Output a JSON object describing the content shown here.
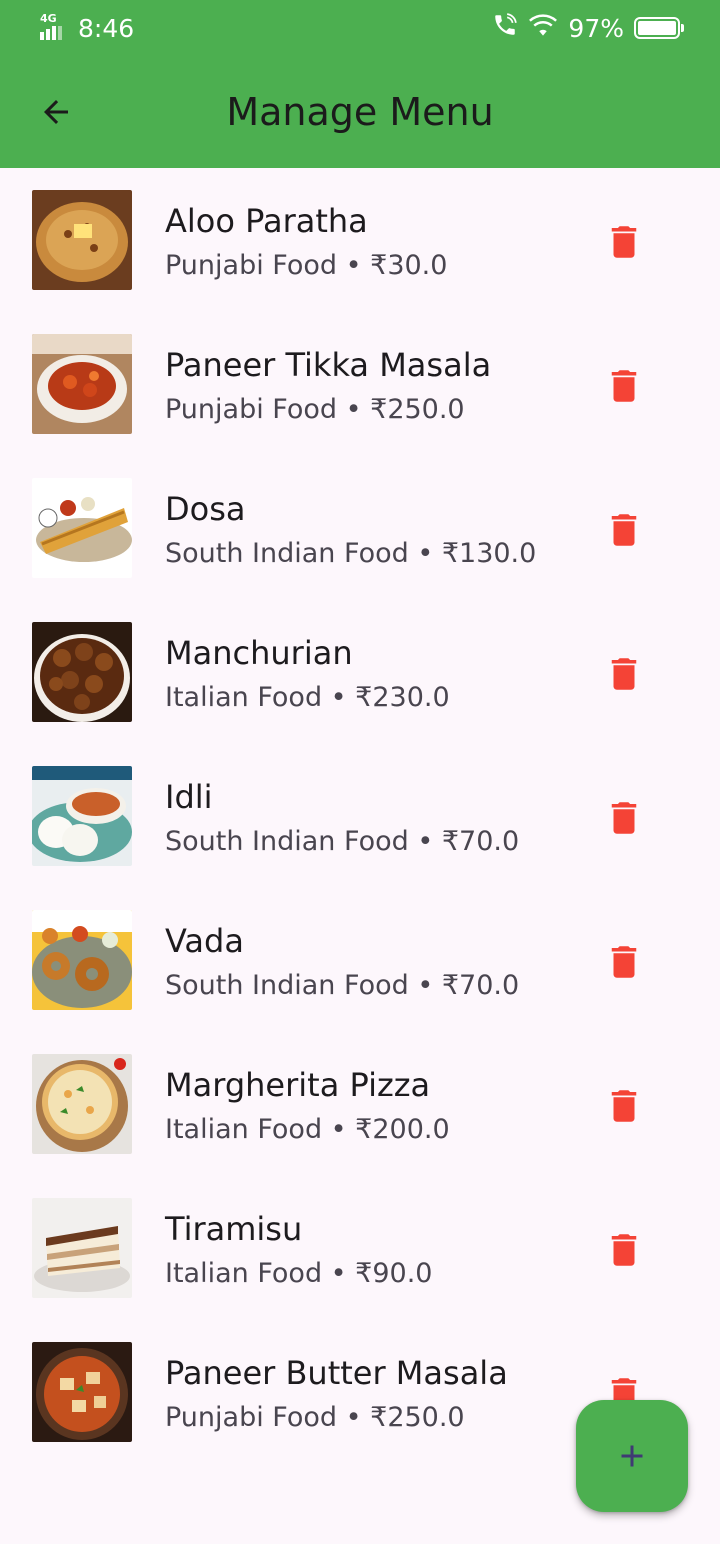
{
  "status_bar": {
    "time": "8:46",
    "network": "4G",
    "battery": "97%",
    "icons": [
      "signal-icon",
      "call-wifi-icon",
      "wifi-icon",
      "battery-icon"
    ]
  },
  "app_bar": {
    "title": "Manage Menu",
    "back_icon": "arrow-back-icon",
    "color": "#4caf50"
  },
  "menu_items": [
    {
      "name": "Aloo Paratha",
      "category": "Punjabi Food",
      "price": "₹30.0",
      "subtitle": "Punjabi Food • ₹30.0"
    },
    {
      "name": "Paneer Tikka Masala",
      "category": "Punjabi Food",
      "price": "₹250.0",
      "subtitle": "Punjabi Food • ₹250.0"
    },
    {
      "name": "Dosa",
      "category": "South Indian Food",
      "price": "₹130.0",
      "subtitle": "South Indian Food • ₹130.0"
    },
    {
      "name": "Manchurian",
      "category": "Italian Food",
      "price": "₹230.0",
      "subtitle": "Italian Food • ₹230.0"
    },
    {
      "name": "Idli",
      "category": "South Indian Food",
      "price": "₹70.0",
      "subtitle": "South Indian Food • ₹70.0"
    },
    {
      "name": "Vada",
      "category": "South Indian Food",
      "price": "₹70.0",
      "subtitle": "South Indian Food • ₹70.0"
    },
    {
      "name": "Margherita Pizza",
      "category": "Italian Food",
      "price": "₹200.0",
      "subtitle": "Italian Food • ₹200.0"
    },
    {
      "name": "Tiramisu",
      "category": "Italian Food",
      "price": "₹90.0",
      "subtitle": "Italian Food • ₹90.0"
    },
    {
      "name": "Paneer Butter Masala",
      "category": "Punjabi Food",
      "price": "₹250.0",
      "subtitle": "Punjabi Food • ₹250.0"
    }
  ],
  "delete_icon": "delete-icon",
  "delete_color": "#f44336",
  "fab": {
    "icon": "add-icon",
    "color": "#4caf50",
    "icon_color": "#3f3a73"
  }
}
